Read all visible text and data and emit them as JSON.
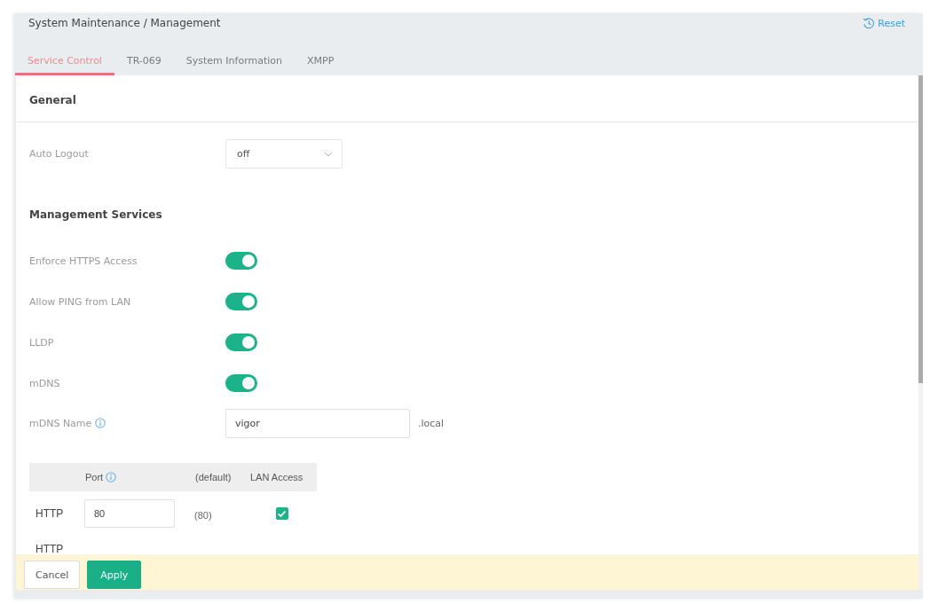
{
  "header": {
    "title": "System Maintenance / Management",
    "reset": "Reset"
  },
  "tabs": [
    {
      "label": "Service Control",
      "selected": true
    },
    {
      "label": "TR-069",
      "selected": false
    },
    {
      "label": "System Information",
      "selected": false
    },
    {
      "label": "XMPP",
      "selected": false
    }
  ],
  "general": {
    "title": "General",
    "rows": [
      {
        "kind": "select",
        "label": "Auto Logout",
        "value": "off"
      }
    ]
  },
  "management_services": {
    "title": "Management Services",
    "rows": [
      {
        "kind": "toggle",
        "label": "Enforce HTTPS Access",
        "on": true
      },
      {
        "kind": "toggle",
        "label": "Allow PING from LAN",
        "on": true
      },
      {
        "kind": "toggle",
        "label": "LLDP",
        "on": true
      },
      {
        "kind": "toggle",
        "label": "mDNS",
        "on": true
      },
      {
        "kind": "text",
        "label": "mDNS Name",
        "info": true,
        "value": "vigor",
        "suffix": ".local"
      }
    ]
  },
  "port_table": {
    "columns": [
      {
        "label": "Port",
        "info": true
      },
      {
        "label": "(default)"
      },
      {
        "label": "LAN Access"
      }
    ],
    "rows": [
      {
        "service": "HTTP",
        "port": "80",
        "default": "(80)",
        "lan_access": true
      },
      {
        "service": "HTTP"
      }
    ]
  },
  "footer": {
    "buttons": [
      {
        "label": "Cancel",
        "kind": "secondary"
      },
      {
        "label": "Apply",
        "kind": "primary"
      }
    ]
  }
}
